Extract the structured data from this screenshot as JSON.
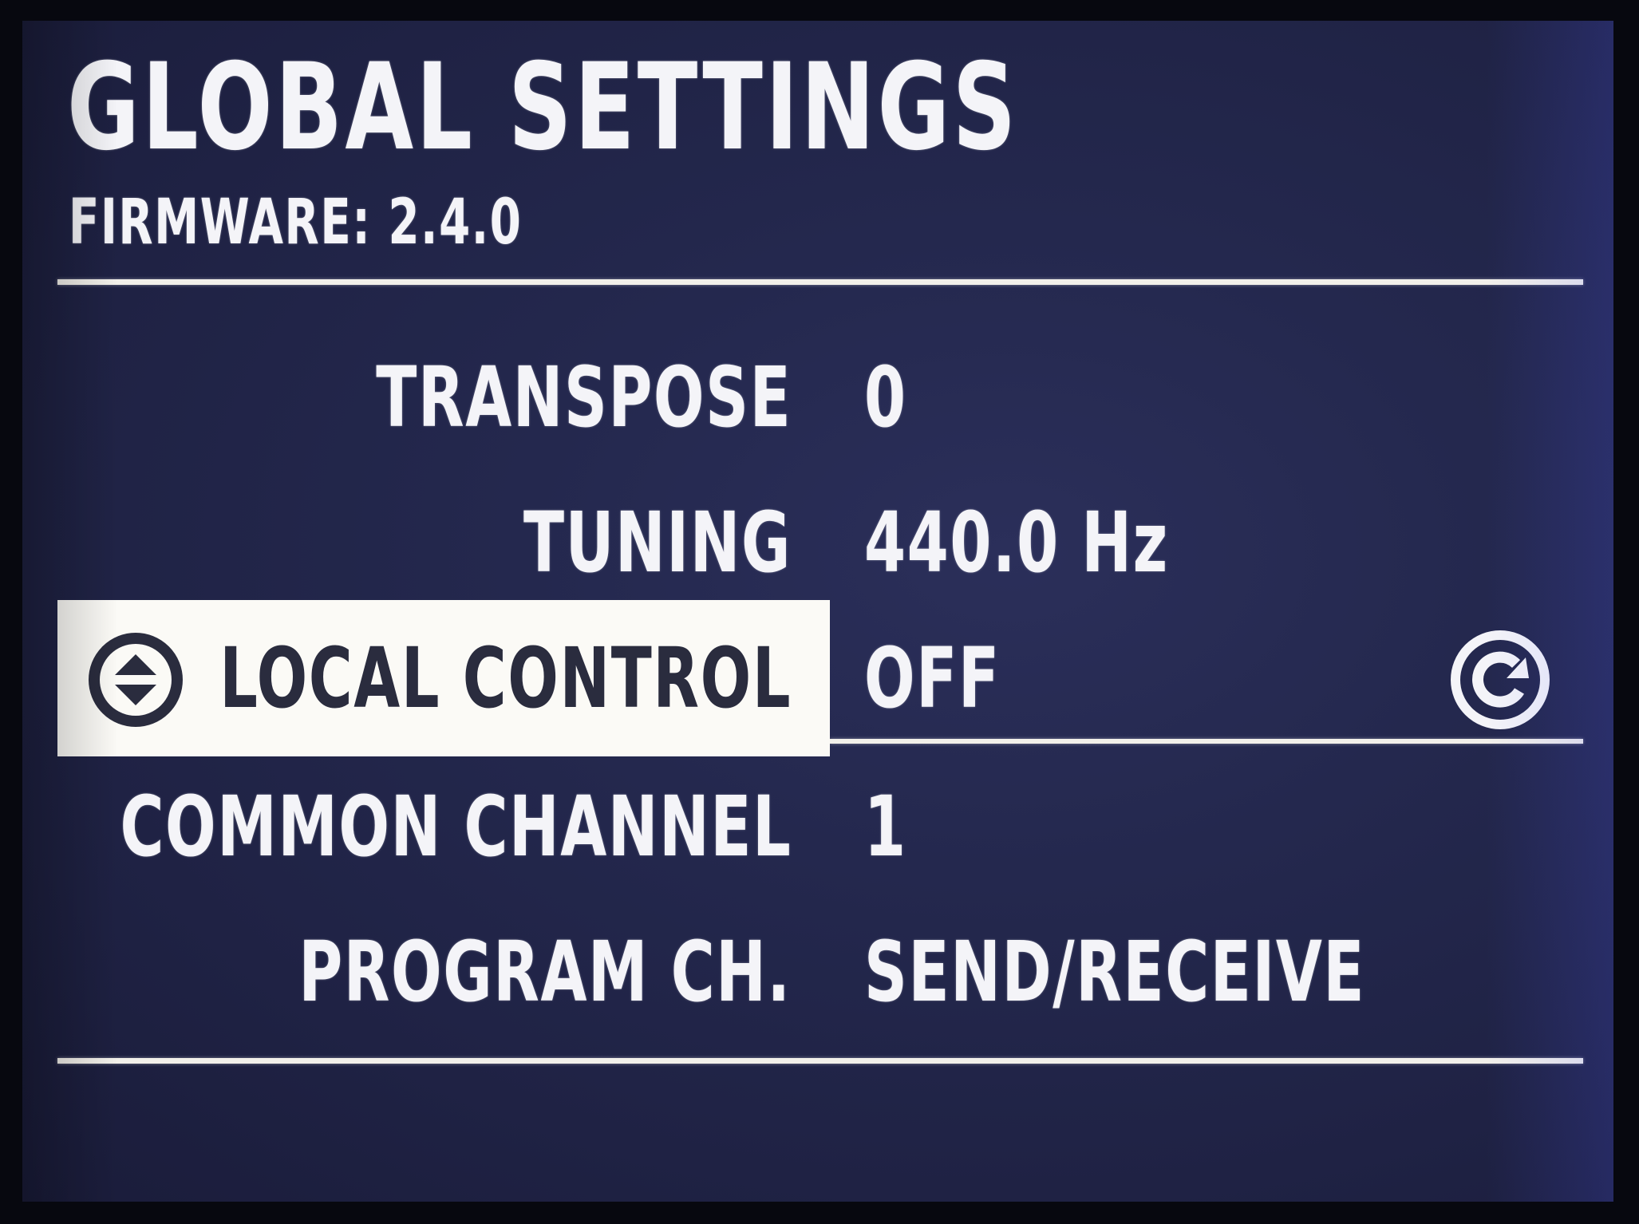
{
  "header": {
    "title": "GLOBAL SETTINGS",
    "firmware": "FIRMWARE: 2.4.0"
  },
  "settings": [
    {
      "label": "TRANSPOSE",
      "value": "0",
      "selected": false
    },
    {
      "label": "TUNING",
      "value": "440.0 Hz",
      "selected": false
    },
    {
      "label": "LOCAL CONTROL",
      "value": "OFF",
      "selected": true
    },
    {
      "label": "COMMON CHANNEL",
      "value": "1",
      "selected": false
    },
    {
      "label": "PROGRAM CH.",
      "value": "SEND/RECEIVE",
      "selected": false
    }
  ],
  "icons": {
    "selection": "up-down-arrows-icon",
    "reset": "reset-circular-arrow-icon"
  },
  "colors": {
    "screen_background": "#24284e",
    "text": "#f4f4f8",
    "highlight": "#fbfaf6",
    "highlight_text": "#2a2c3e"
  }
}
